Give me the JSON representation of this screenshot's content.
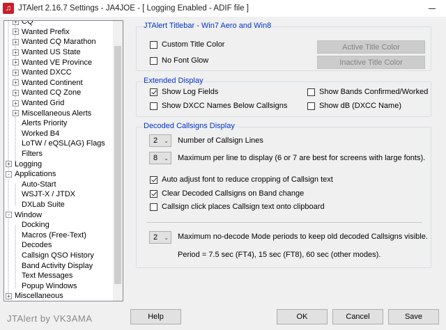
{
  "window": {
    "title": "JTAlert 2.16.7 Settings  -  JA4JOE  -  [ Logging Enabled - ADIF file ]",
    "app_icon_glyph": "♫"
  },
  "tree": {
    "items": [
      {
        "label": "CQ",
        "expander": "+",
        "level": 1
      },
      {
        "label": "Wanted Prefix",
        "expander": "+",
        "level": 1
      },
      {
        "label": "Wanted CQ Marathon",
        "expander": "+",
        "level": 1
      },
      {
        "label": "Wanted US State",
        "expander": "+",
        "level": 1
      },
      {
        "label": "Wanted VE Province",
        "expander": "+",
        "level": 1
      },
      {
        "label": "Wanted DXCC",
        "expander": "+",
        "level": 1
      },
      {
        "label": "Wanted Continent",
        "expander": "+",
        "level": 1
      },
      {
        "label": "Wanted CQ Zone",
        "expander": "+",
        "level": 1
      },
      {
        "label": "Wanted Grid",
        "expander": "+",
        "level": 1
      },
      {
        "label": "Miscellaneous Alerts",
        "expander": "+",
        "level": 1
      },
      {
        "label": "Alerts Priority",
        "expander": "",
        "level": 1
      },
      {
        "label": "Worked B4",
        "expander": "",
        "level": 1
      },
      {
        "label": "LoTW / eQSL(AG) Flags",
        "expander": "",
        "level": 1
      },
      {
        "label": "Filters",
        "expander": "",
        "level": 1
      },
      {
        "label": "Logging",
        "expander": "+",
        "level": 0
      },
      {
        "label": "Applications",
        "expander": "-",
        "level": 0
      },
      {
        "label": "Auto-Start",
        "expander": "",
        "level": 1
      },
      {
        "label": "WSJT-X / JTDX",
        "expander": "",
        "level": 1
      },
      {
        "label": "DXLab Suite",
        "expander": "",
        "level": 1
      },
      {
        "label": "Window",
        "expander": "-",
        "level": 0
      },
      {
        "label": "Docking",
        "expander": "",
        "level": 1
      },
      {
        "label": "Macros (Free-Text)",
        "expander": "",
        "level": 1
      },
      {
        "label": "Decodes",
        "expander": "",
        "level": 1
      },
      {
        "label": "Callsign QSO History",
        "expander": "",
        "level": 1
      },
      {
        "label": "Band Activity Display",
        "expander": "",
        "level": 1
      },
      {
        "label": "Text Messages",
        "expander": "",
        "level": 1
      },
      {
        "label": "Popup Windows",
        "expander": "",
        "level": 1
      },
      {
        "label": "Miscellaneous",
        "expander": "+",
        "level": 0
      }
    ]
  },
  "brand": "JTAlert by VK3AMA",
  "titlebar_group": {
    "title": "JTAlert Titlebar - Win7 Aero and Win8",
    "custom_title_color": {
      "label": "Custom Title Color",
      "checked": false
    },
    "no_font_glow": {
      "label": "No Font Glow",
      "checked": false
    },
    "active_title_color_button": "Active Title Color",
    "inactive_title_color_button": "Inactive Title Color"
  },
  "extended_group": {
    "title": "Extended Display",
    "show_log_fields": {
      "label": "Show Log Fields",
      "checked": true
    },
    "show_dxcc_names": {
      "label": "Show DXCC Names Below Callsigns",
      "checked": false
    },
    "show_bands_confirmed": {
      "label": "Show Bands Confirmed/Worked",
      "checked": false
    },
    "show_db": {
      "label": "Show dB (DXCC Name)",
      "checked": false
    }
  },
  "decoded_group": {
    "title": "Decoded Callsigns Display",
    "callsign_lines": {
      "value": "2",
      "label": "Number of Callsign Lines"
    },
    "max_per_line": {
      "value": "8",
      "label": "Maximum per line to display (6 or 7 are best for screens with large fonts)."
    },
    "auto_adjust_font": {
      "label": "Auto adjust font to reduce cropping of Callsign text",
      "checked": true
    },
    "clear_on_band_change": {
      "label": "Clear Decoded Callsigns on Band change",
      "checked": true
    },
    "click_to_clipboard": {
      "label": "Callsign click places Callsign text onto clipboard",
      "checked": false
    },
    "max_nodecode_periods": {
      "value": "2",
      "label": "Maximum no-decode Mode periods to keep old decoded Callsigns visible."
    },
    "period_note": "Period = 7.5 sec (FT4), 15 sec (FT8), 60 sec (other modes)."
  },
  "buttons": {
    "help": "Help",
    "ok": "OK",
    "cancel": "Cancel",
    "save": "Save"
  },
  "icons": {
    "dropdown": "chevron-down-icon",
    "tree_plus": "plus-box-icon",
    "tree_minus": "minus-box-icon"
  }
}
